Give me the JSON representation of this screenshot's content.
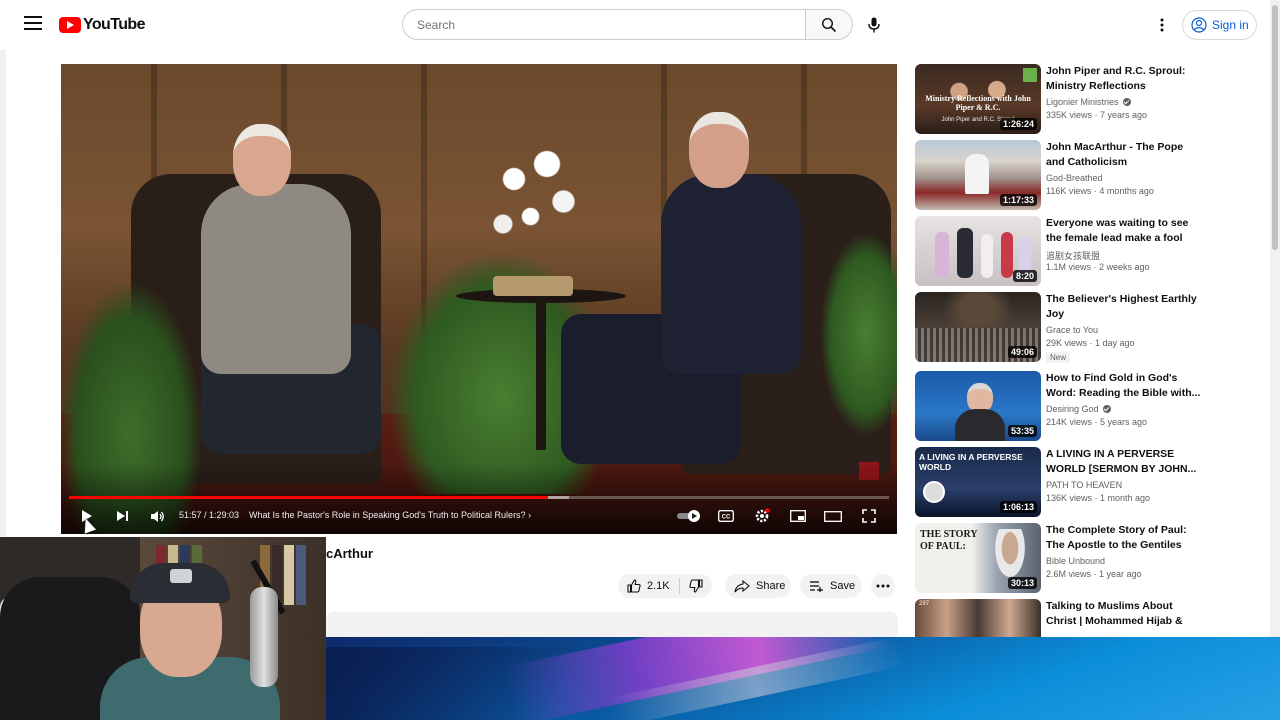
{
  "header": {
    "logo_text": "YouTube",
    "search_placeholder": "Search",
    "signin_label": "Sign in"
  },
  "player": {
    "time": "51:57 / 1:29:03",
    "chapter": "What Is the Pastor's Role in Speaking God's Truth to Political Rulers?",
    "progress_fraction": 0.584,
    "buffer_fraction": 0.61
  },
  "video": {
    "title_visible": "cArthur",
    "likes": "2.1K",
    "share_label": "Share",
    "save_label": "Save"
  },
  "recommendations": [
    {
      "title": "John Piper and R.C. Sproul: Ministry Reflections",
      "channel": "Ligonier Ministries",
      "verified": true,
      "meta": "335K views · 7 years ago",
      "duration": "1:26:24",
      "thumb_text": "Ministry Reflections with John Piper & R.C.",
      "thumb_sub": "John Piper and R.C. Sproul"
    },
    {
      "title": "John MacArthur - The Pope and Catholicism",
      "channel": "God-Breathed",
      "verified": false,
      "meta": "116K views · 4 months ago",
      "duration": "1:17:33"
    },
    {
      "title": "Everyone was waiting to see the female lead make a fool of...",
      "channel": "追剧女孩联盟",
      "verified": false,
      "meta": "1.1M views · 2 weeks ago",
      "duration": "8:20"
    },
    {
      "title": "The Believer's Highest Earthly Joy",
      "channel": "Grace to You",
      "verified": false,
      "meta": "29K views · 1 day ago",
      "duration": "49:06",
      "badge": "New"
    },
    {
      "title": "How to Find Gold in God's Word: Reading the Bible with...",
      "channel": "Desiring God",
      "verified": true,
      "meta": "214K views · 5 years ago",
      "duration": "53:35"
    },
    {
      "title": "A LIVING IN A PERVERSE WORLD [SERMON BY JOHN...",
      "channel": "PATH TO HEAVEN",
      "verified": false,
      "meta": "136K views · 1 month ago",
      "duration": "1:06:13",
      "thumb_text": "A LIVING IN A PERVERSE WORLD"
    },
    {
      "title": "The Complete Story of Paul: The Apostle to the Gentiles",
      "channel": "Bible Unbound",
      "verified": false,
      "meta": "2.6M views · 1 year ago",
      "duration": "30:13",
      "thumb_text": "THE STORY OF PAUL:"
    },
    {
      "title": "Talking to Muslims About Christ | Mohammed Hijab & Jonatha...",
      "channel": "",
      "verified": false,
      "meta": "",
      "duration": "",
      "thumb_text": "297"
    }
  ],
  "colors": {
    "brand_red": "#ff0000",
    "link_blue": "#065fd4",
    "meta_gray": "#606060"
  }
}
